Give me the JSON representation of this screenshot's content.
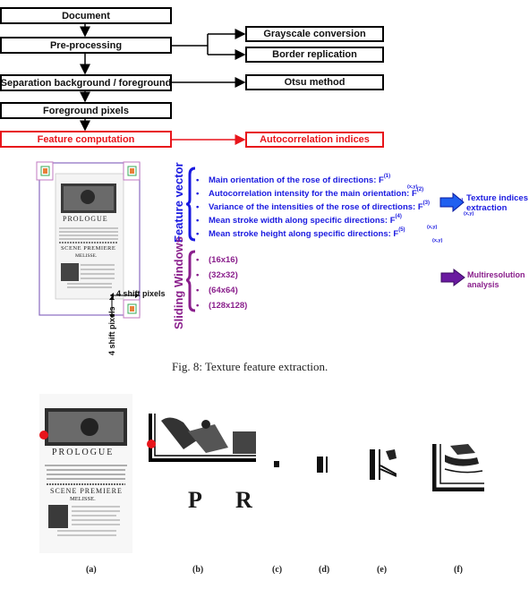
{
  "flowchart": {
    "main_steps": [
      {
        "label": "Document",
        "highlight": false
      },
      {
        "label": "Pre-processing",
        "highlight": false
      },
      {
        "label": "Separation background / foreground",
        "highlight": false
      },
      {
        "label": "Foreground pixels",
        "highlight": false
      },
      {
        "label": "Feature computation",
        "highlight": true
      }
    ],
    "side_steps": [
      {
        "label": "Grayscale conversion",
        "from": "Pre-processing"
      },
      {
        "label": "Border replication",
        "from": "Pre-processing"
      },
      {
        "label": "Otsu method",
        "from": "Separation background / foreground"
      },
      {
        "label": "Autocorrelation indices",
        "from": "Feature computation",
        "highlight": true
      }
    ]
  },
  "illustration": {
    "shift_horizontal_label": "4 shift pixels",
    "shift_vertical_label": "4 shift pixels",
    "page_text": {
      "title": "PROLOGUE",
      "scene": "SCENE PREMIERE",
      "character": "MELISSE."
    }
  },
  "feature_vector": {
    "heading": "Feature vector",
    "items": [
      {
        "text": "Main orientation of the rose of directions: F",
        "sup": "(1)",
        "sub": "(x,y)"
      },
      {
        "text": "Autocorrelation intensity for the main orientation: F",
        "sup": "(2)",
        "sub": "(x,y)"
      },
      {
        "text": "Variance of the  intensities of the rose of directions: F",
        "sup": "(3)",
        "sub": "(x,y)"
      },
      {
        "text": "Mean stroke width along specific directions: F",
        "sup": "(4)",
        "sub": "(x,y)"
      },
      {
        "text": "Mean stroke height along specific directions: F",
        "sup": "(5)",
        "sub": "(x,y)"
      }
    ],
    "result_label_line1": "Texture indices",
    "result_label_line2": "extraction"
  },
  "sliding_windows": {
    "heading": "Sliding Windows",
    "items": [
      "(16x16)",
      "(32x32)",
      "(64x64)",
      "(128x128)"
    ],
    "result_label_line1": "Multiresolution",
    "result_label_line2": "analysis"
  },
  "bullet": "•",
  "colors": {
    "feature_blue": "#1a1ae0",
    "window_purple": "#8a1f8c",
    "highlight_red": "#e8151b"
  },
  "figure_caption": "Fig. 8: Texture feature extraction.",
  "subfigures": {
    "labels": [
      "(a)",
      "(b)",
      "(c)",
      "(d)",
      "(e)",
      "(f)"
    ],
    "page_text": {
      "title": "PROLOGUE",
      "scene": "SCENE PREMIERE",
      "character": "MELISSE.",
      "zoom_letters": "P R"
    }
  }
}
